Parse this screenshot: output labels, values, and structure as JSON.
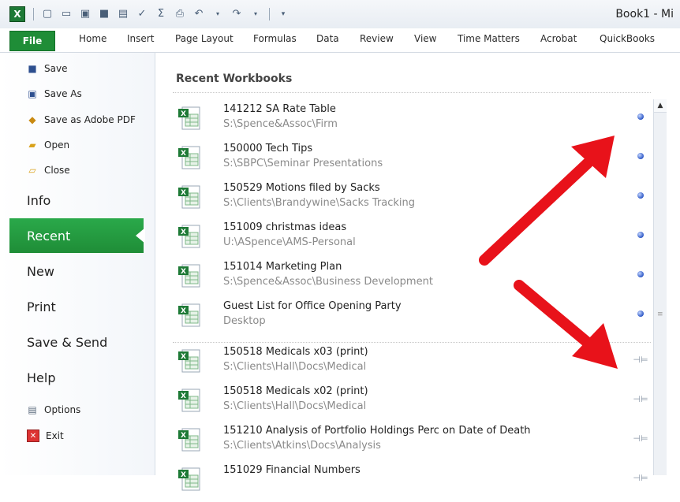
{
  "window": {
    "title": "Book1 - Mi"
  },
  "qat": {
    "icons": [
      "excel-logo",
      "new-icon",
      "open-icon",
      "save-as-icon",
      "save-icon",
      "print-preview-icon",
      "spelling-icon",
      "sum-icon",
      "print-icon",
      "undo-icon",
      "redo-icon",
      "customize-icon"
    ]
  },
  "tabs": {
    "file": "File",
    "items": [
      "Home",
      "Insert",
      "Page Layout",
      "Formulas",
      "Data",
      "Review",
      "View",
      "Time Matters",
      "Acrobat",
      "QuickBooks"
    ]
  },
  "nav": {
    "commands_top": [
      "Save",
      "Save As",
      "Save as Adobe PDF",
      "Open",
      "Close"
    ],
    "tabs": [
      "Info",
      "Recent",
      "New",
      "Print",
      "Save & Send",
      "Help"
    ],
    "active_tab": "Recent",
    "commands_bottom": [
      "Options",
      "Exit"
    ]
  },
  "main": {
    "heading": "Recent Workbooks",
    "pinned": [
      {
        "name": "141212 SA Rate Table",
        "path": "S:\\Spence&Assoc\\Firm"
      },
      {
        "name": "150000 Tech Tips",
        "path": "S:\\SBPC\\Seminar Presentations"
      },
      {
        "name": "150529 Motions filed by Sacks",
        "path": "S:\\Clients\\Brandywine\\Sacks Tracking"
      },
      {
        "name": "151009 christmas ideas",
        "path": "U:\\ASpence\\AMS-Personal"
      },
      {
        "name": "151014 Marketing Plan",
        "path": "S:\\Spence&Assoc\\Business Development"
      },
      {
        "name": "Guest List for Office Opening Party",
        "path": "Desktop"
      }
    ],
    "unpinned": [
      {
        "name": "150518 Medicals x03 (print)",
        "path": "S:\\Clients\\Hall\\Docs\\Medical"
      },
      {
        "name": "150518 Medicals x02 (print)",
        "path": "S:\\Clients\\Hall\\Docs\\Medical"
      },
      {
        "name": "151210 Analysis of Portfolio Holdings Perc on Date of Death",
        "path": "S:\\Clients\\Atkins\\Docs\\Analysis"
      },
      {
        "name": "151029 Financial Numbers",
        "path": ""
      }
    ]
  },
  "colors": {
    "accent": "#1f8d37",
    "annotation_arrow": "#e8121a"
  }
}
